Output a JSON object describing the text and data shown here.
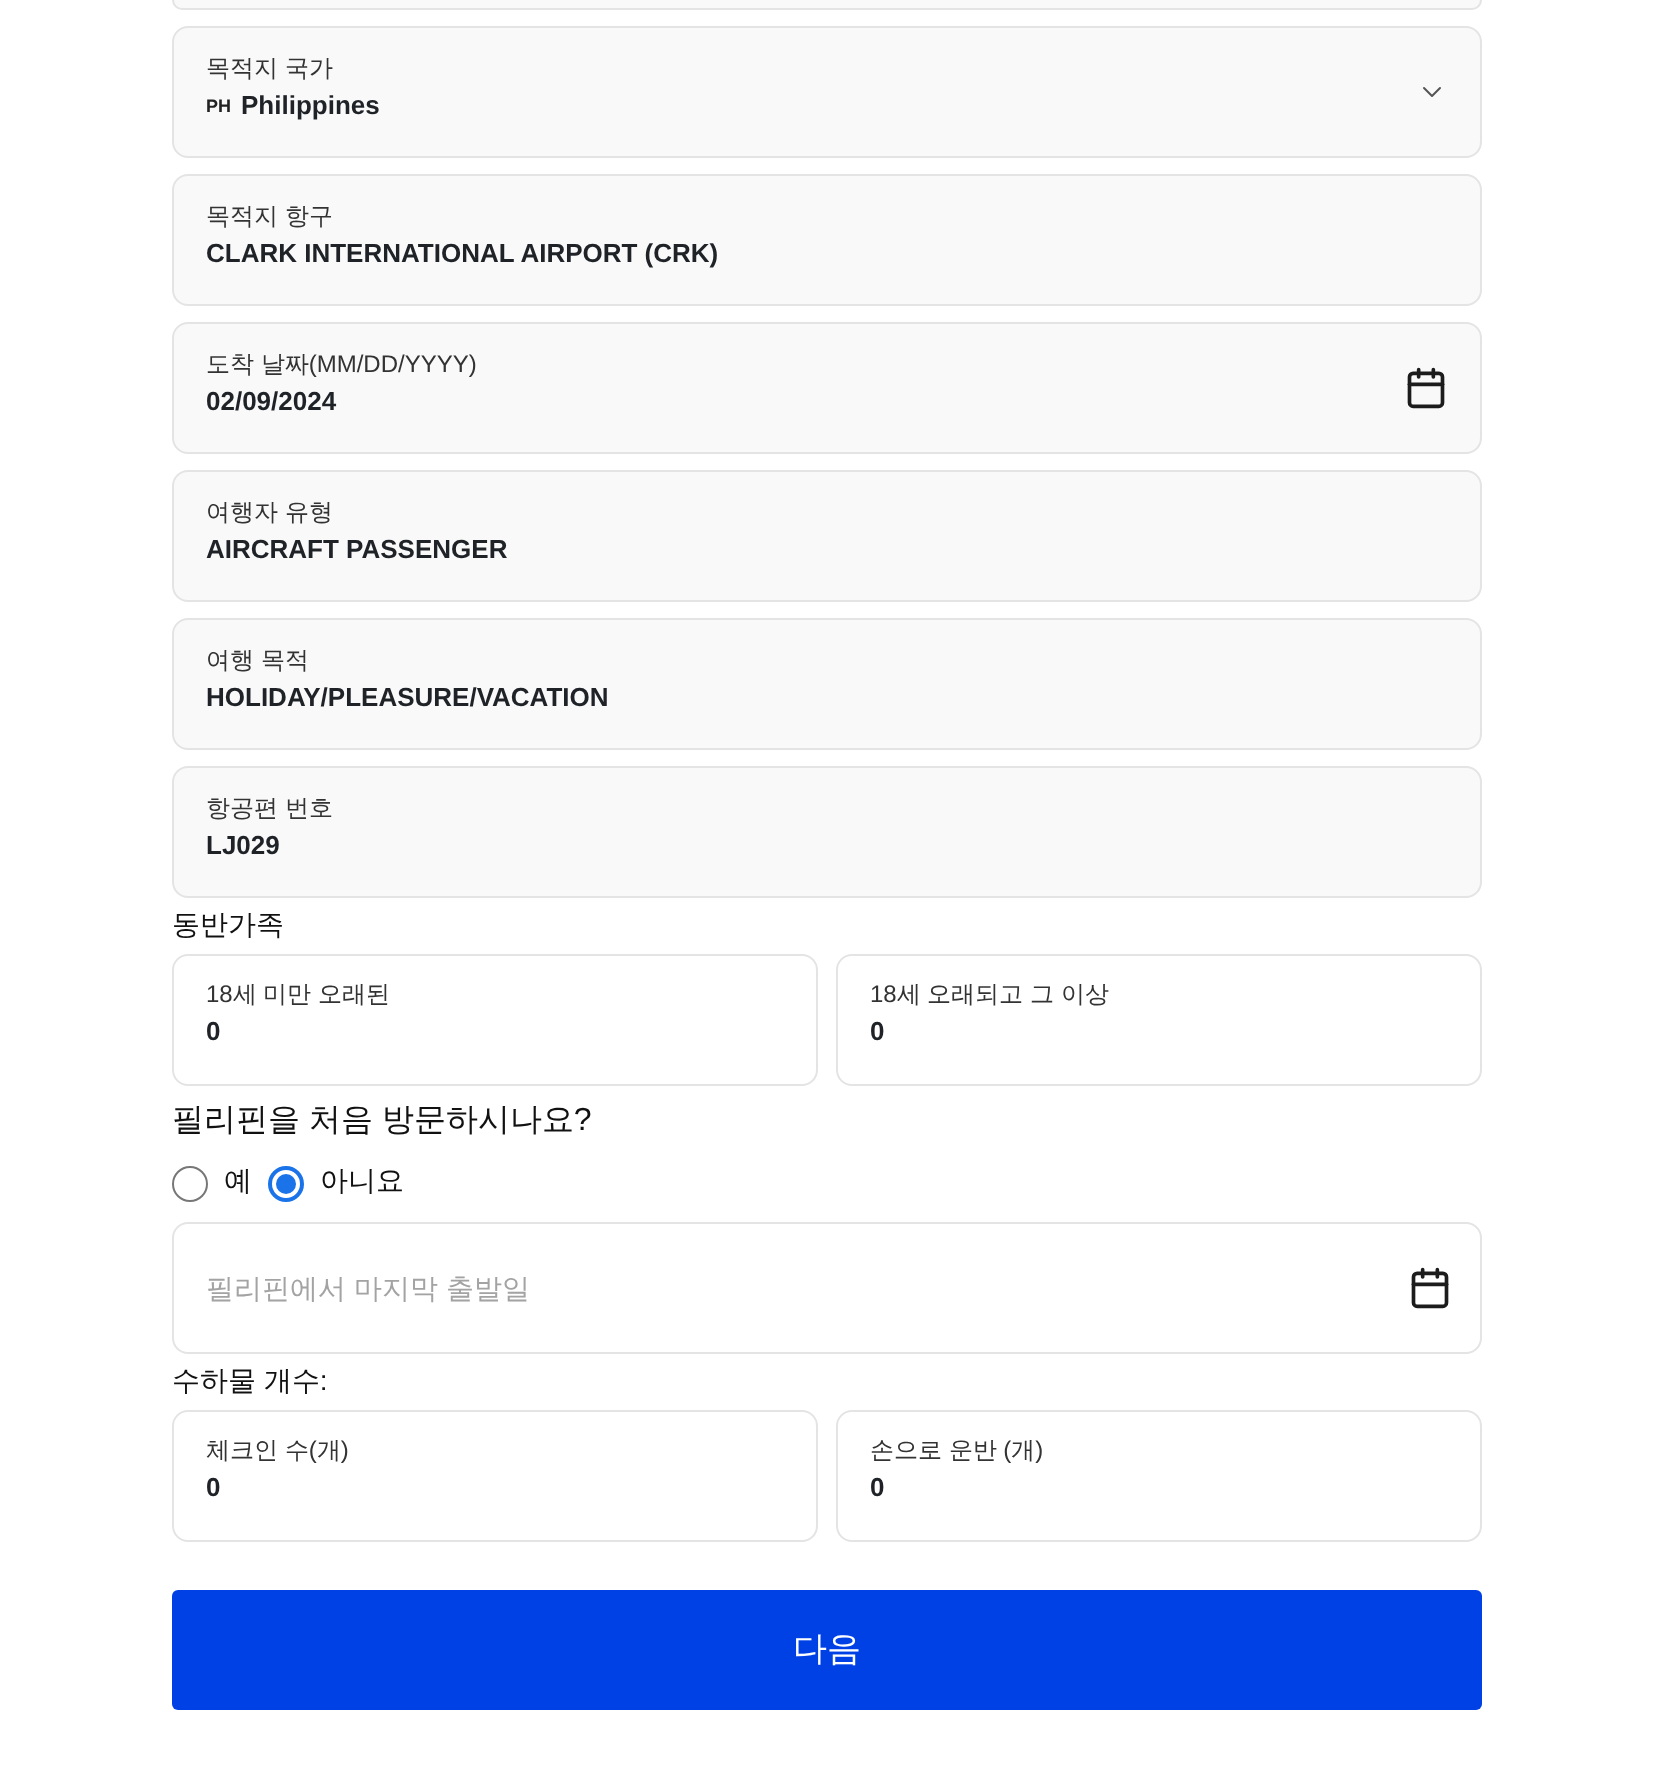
{
  "fields": [
    {
      "kind": "select",
      "label": "목적지 국가",
      "flag": "PH",
      "value": "Philippines"
    },
    {
      "kind": "text",
      "label": "목적지 항구",
      "value": "CLARK INTERNATIONAL AIRPORT (CRK)"
    },
    {
      "kind": "date",
      "label": "도착 날짜(MM/DD/YYYY)",
      "value": "02/09/2024"
    },
    {
      "kind": "text",
      "label": "여행자 유형",
      "value": "AIRCRAFT PASSENGER"
    },
    {
      "kind": "text",
      "label": "여행 목적",
      "value": "HOLIDAY/PLEASURE/VACATION"
    },
    {
      "kind": "text",
      "label": "항공편 번호",
      "value": "LJ029"
    }
  ],
  "companions": {
    "title": "동반가족",
    "fields": [
      {
        "label": "18세 미만 오래된",
        "value": "0"
      },
      {
        "label": "18세 오래되고 그 이상",
        "value": "0"
      }
    ]
  },
  "first_visit": {
    "question": "필리핀을 처음 방문하시나요?",
    "options": [
      {
        "label": "예",
        "selected": false
      },
      {
        "label": "아니요",
        "selected": true
      }
    ]
  },
  "last_departure": {
    "kind": "date",
    "placeholder": "필리핀에서 마지막 출발일"
  },
  "luggage": {
    "title": "수하물 개수:",
    "fields": [
      {
        "label": "체크인 수(개)",
        "value": "0"
      },
      {
        "label": "손으로 운반 (개)",
        "value": "0"
      }
    ]
  },
  "next_button": "다음"
}
